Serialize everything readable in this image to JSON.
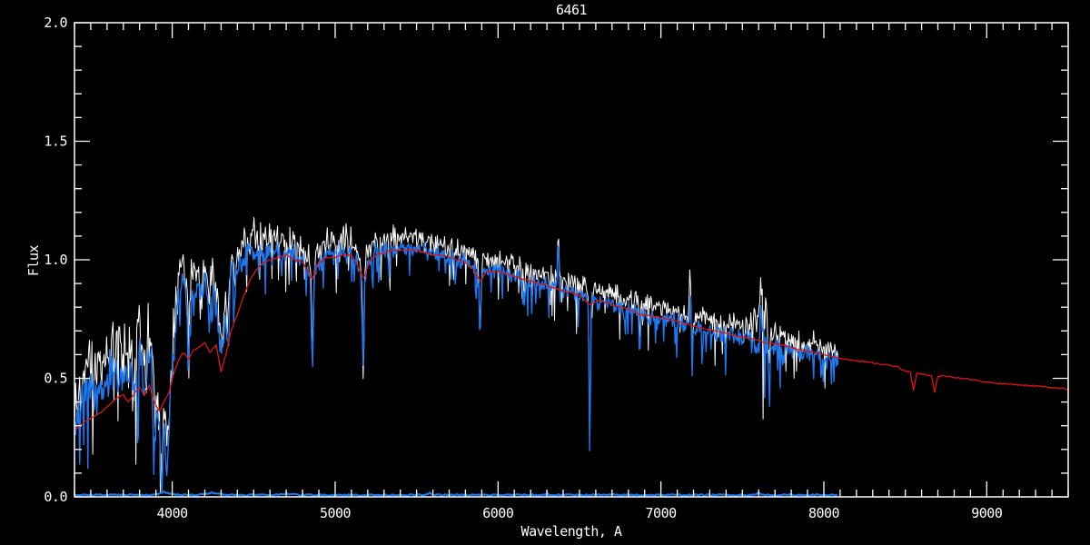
{
  "title": "6461",
  "colors": {
    "background": "#000000",
    "frame": "#ffffff",
    "observed_raw": "#ffffff",
    "observed_smoothed": "#1e78f0",
    "model_fit": "#e01414",
    "text": "#ffffff"
  },
  "chart_data": {
    "type": "line",
    "title": "6461",
    "xlabel": "Wavelength, A",
    "ylabel": "Flux",
    "xlim": [
      3400,
      9500
    ],
    "ylim": [
      0.0,
      2.0
    ],
    "grid": false,
    "legend": null,
    "x_major_ticks": [
      4000,
      5000,
      6000,
      7000,
      8000,
      9000
    ],
    "x_tick_labels": [
      "4000",
      "5000",
      "6000",
      "7000",
      "8000",
      "9000"
    ],
    "x_minor_step": 100,
    "y_major_ticks": [
      0.0,
      0.5,
      1.0,
      1.5,
      2.0
    ],
    "y_tick_labels": [
      "0.0",
      "0.5",
      "1.0",
      "1.5",
      "2.0"
    ],
    "y_minor_step": 0.1,
    "seed": 77731,
    "observed_range": [
      3402,
      8090
    ],
    "series": [
      {
        "name": "observed-raw",
        "color": "#ffffff",
        "style": "noisy",
        "offset": 0.02,
        "noise_scale": 1.3,
        "bias": 0.5,
        "stroke": 1.0
      },
      {
        "name": "observed-smoothed",
        "color": "#1e78f0",
        "style": "noisy",
        "offset": 0.0,
        "noise_scale": 1.0,
        "bias": 0.0,
        "stroke": 1.4
      },
      {
        "name": "noise-floor",
        "color": "#1e78f0",
        "style": "flat",
        "xrange": [
          3402,
          8090
        ],
        "level": 0.008,
        "stroke": 2.2
      },
      {
        "name": "model-fit",
        "color": "#e01414",
        "style": "smooth",
        "stroke": 1.3,
        "jitter": 0.006,
        "points": [
          [
            3400,
            0.28
          ],
          [
            3450,
            0.31
          ],
          [
            3500,
            0.33
          ],
          [
            3550,
            0.35
          ],
          [
            3600,
            0.38
          ],
          [
            3650,
            0.41
          ],
          [
            3700,
            0.43
          ],
          [
            3730,
            0.4
          ],
          [
            3770,
            0.44
          ],
          [
            3800,
            0.46
          ],
          [
            3830,
            0.43
          ],
          [
            3860,
            0.47
          ],
          [
            3890,
            0.4
          ],
          [
            3920,
            0.36
          ],
          [
            3950,
            0.4
          ],
          [
            3980,
            0.44
          ],
          [
            4010,
            0.52
          ],
          [
            4040,
            0.58
          ],
          [
            4070,
            0.61
          ],
          [
            4100,
            0.58
          ],
          [
            4130,
            0.62
          ],
          [
            4160,
            0.63
          ],
          [
            4200,
            0.65
          ],
          [
            4230,
            0.61
          ],
          [
            4270,
            0.64
          ],
          [
            4300,
            0.53
          ],
          [
            4330,
            0.6
          ],
          [
            4360,
            0.7
          ],
          [
            4400,
            0.77
          ],
          [
            4440,
            0.85
          ],
          [
            4480,
            0.92
          ],
          [
            4520,
            0.96
          ],
          [
            4560,
            0.99
          ],
          [
            4600,
            1.0
          ],
          [
            4650,
            1.01
          ],
          [
            4700,
            1.02
          ],
          [
            4750,
            1.0
          ],
          [
            4800,
            0.99
          ],
          [
            4861,
            0.92
          ],
          [
            4900,
            0.99
          ],
          [
            4950,
            1.01
          ],
          [
            5000,
            1.01
          ],
          [
            5050,
            1.02
          ],
          [
            5100,
            1.02
          ],
          [
            5140,
            0.97
          ],
          [
            5175,
            0.92
          ],
          [
            5210,
            0.99
          ],
          [
            5250,
            1.02
          ],
          [
            5300,
            1.03
          ],
          [
            5350,
            1.04
          ],
          [
            5400,
            1.04
          ],
          [
            5450,
            1.04
          ],
          [
            5500,
            1.04
          ],
          [
            5550,
            1.03
          ],
          [
            5600,
            1.02
          ],
          [
            5650,
            1.02
          ],
          [
            5700,
            1.01
          ],
          [
            5750,
            1.0
          ],
          [
            5800,
            0.99
          ],
          [
            5850,
            0.96
          ],
          [
            5893,
            0.91
          ],
          [
            5930,
            0.95
          ],
          [
            6000,
            0.95
          ],
          [
            6100,
            0.93
          ],
          [
            6200,
            0.91
          ],
          [
            6300,
            0.89
          ],
          [
            6400,
            0.87
          ],
          [
            6500,
            0.85
          ],
          [
            6563,
            0.81
          ],
          [
            6620,
            0.83
          ],
          [
            6700,
            0.81
          ],
          [
            6800,
            0.79
          ],
          [
            6870,
            0.77
          ],
          [
            6950,
            0.76
          ],
          [
            7050,
            0.75
          ],
          [
            7150,
            0.73
          ],
          [
            7250,
            0.71
          ],
          [
            7350,
            0.7
          ],
          [
            7450,
            0.68
          ],
          [
            7550,
            0.67
          ],
          [
            7650,
            0.65
          ],
          [
            7750,
            0.64
          ],
          [
            7850,
            0.62
          ],
          [
            7950,
            0.61
          ],
          [
            8050,
            0.59
          ],
          [
            8150,
            0.58
          ],
          [
            8250,
            0.57
          ],
          [
            8350,
            0.56
          ],
          [
            8450,
            0.55
          ],
          [
            8500,
            0.53
          ],
          [
            8530,
            0.53
          ],
          [
            8550,
            0.45
          ],
          [
            8570,
            0.52
          ],
          [
            8600,
            0.52
          ],
          [
            8660,
            0.51
          ],
          [
            8680,
            0.44
          ],
          [
            8700,
            0.51
          ],
          [
            8750,
            0.51
          ],
          [
            8850,
            0.5
          ],
          [
            8950,
            0.49
          ],
          [
            9050,
            0.48
          ],
          [
            9150,
            0.475
          ],
          [
            9250,
            0.47
          ],
          [
            9350,
            0.465
          ],
          [
            9500,
            0.455
          ]
        ]
      }
    ],
    "observed_envelope": [
      [
        3402,
        0.3
      ],
      [
        3450,
        0.4
      ],
      [
        3500,
        0.46
      ],
      [
        3550,
        0.42
      ],
      [
        3600,
        0.5
      ],
      [
        3650,
        0.54
      ],
      [
        3700,
        0.55
      ],
      [
        3730,
        0.48
      ],
      [
        3760,
        0.55
      ],
      [
        3800,
        0.62
      ],
      [
        3830,
        0.55
      ],
      [
        3860,
        0.62
      ],
      [
        3890,
        0.48
      ],
      [
        3915,
        0.32
      ],
      [
        3935,
        0.25
      ],
      [
        3955,
        0.3
      ],
      [
        3975,
        0.28
      ],
      [
        4000,
        0.55
      ],
      [
        4030,
        0.82
      ],
      [
        4060,
        0.9
      ],
      [
        4100,
        0.86
      ],
      [
        4150,
        0.88
      ],
      [
        4200,
        0.9
      ],
      [
        4230,
        0.84
      ],
      [
        4260,
        0.86
      ],
      [
        4290,
        0.68
      ],
      [
        4310,
        0.6
      ],
      [
        4330,
        0.82
      ],
      [
        4360,
        0.94
      ],
      [
        4400,
        0.96
      ],
      [
        4440,
        1.02
      ],
      [
        4480,
        1.05
      ],
      [
        4520,
        1.04
      ],
      [
        4560,
        1.03
      ],
      [
        4600,
        1.03
      ],
      [
        4650,
        1.04
      ],
      [
        4700,
        1.03
      ],
      [
        4750,
        1.01
      ],
      [
        4800,
        1.0
      ],
      [
        4840,
        0.97
      ],
      [
        4880,
        0.96
      ],
      [
        4920,
        1.0
      ],
      [
        4960,
        1.02
      ],
      [
        5000,
        1.02
      ],
      [
        5050,
        1.04
      ],
      [
        5100,
        1.03
      ],
      [
        5140,
        0.99
      ],
      [
        5175,
        0.93
      ],
      [
        5210,
        1.0
      ],
      [
        5250,
        1.03
      ],
      [
        5300,
        1.04
      ],
      [
        5350,
        1.04
      ],
      [
        5400,
        1.05
      ],
      [
        5450,
        1.05
      ],
      [
        5500,
        1.04
      ],
      [
        5550,
        1.03
      ],
      [
        5600,
        1.02
      ],
      [
        5650,
        1.02
      ],
      [
        5700,
        1.01
      ],
      [
        5750,
        1.0
      ],
      [
        5800,
        0.99
      ],
      [
        5850,
        0.97
      ],
      [
        5890,
        0.94
      ],
      [
        5930,
        0.96
      ],
      [
        6000,
        0.95
      ],
      [
        6050,
        0.94
      ],
      [
        6100,
        0.93
      ],
      [
        6150,
        0.92
      ],
      [
        6200,
        0.91
      ],
      [
        6250,
        0.9
      ],
      [
        6300,
        0.89
      ],
      [
        6350,
        0.88
      ],
      [
        6400,
        0.87
      ],
      [
        6450,
        0.86
      ],
      [
        6500,
        0.85
      ],
      [
        6550,
        0.84
      ],
      [
        6600,
        0.83
      ],
      [
        6650,
        0.82
      ],
      [
        6700,
        0.81
      ],
      [
        6750,
        0.8
      ],
      [
        6800,
        0.79
      ],
      [
        6850,
        0.78
      ],
      [
        6900,
        0.77
      ],
      [
        6950,
        0.76
      ],
      [
        7000,
        0.76
      ],
      [
        7050,
        0.75
      ],
      [
        7100,
        0.74
      ],
      [
        7150,
        0.73
      ],
      [
        7200,
        0.72
      ],
      [
        7250,
        0.71
      ],
      [
        7300,
        0.7
      ],
      [
        7350,
        0.69
      ],
      [
        7400,
        0.68
      ],
      [
        7450,
        0.68
      ],
      [
        7500,
        0.67
      ],
      [
        7550,
        0.66
      ],
      [
        7600,
        0.65
      ],
      [
        7650,
        0.64
      ],
      [
        7700,
        0.64
      ],
      [
        7750,
        0.63
      ],
      [
        7800,
        0.62
      ],
      [
        7850,
        0.61
      ],
      [
        7900,
        0.61
      ],
      [
        7950,
        0.6
      ],
      [
        8000,
        0.59
      ],
      [
        8050,
        0.59
      ],
      [
        8090,
        0.58
      ]
    ],
    "absorption_lines": [
      [
        3770,
        0.15,
        8
      ],
      [
        3835,
        0.18,
        8
      ],
      [
        3890,
        0.22,
        8
      ],
      [
        3934,
        0.18,
        9
      ],
      [
        3969,
        0.16,
        9
      ],
      [
        4102,
        0.22,
        7
      ],
      [
        4227,
        0.1,
        4
      ],
      [
        4340,
        0.22,
        6
      ],
      [
        4383,
        0.12,
        4
      ],
      [
        4668,
        0.08,
        4
      ],
      [
        4861,
        0.42,
        5
      ],
      [
        5172,
        0.4,
        5
      ],
      [
        5270,
        0.14,
        4
      ],
      [
        5332,
        0.12,
        4
      ],
      [
        5890,
        0.28,
        5
      ],
      [
        6162,
        0.1,
        4
      ],
      [
        6563,
        0.66,
        4
      ],
      [
        6870,
        0.16,
        4
      ],
      [
        7190,
        0.1,
        4
      ],
      [
        7665,
        0.12,
        5
      ]
    ],
    "emission_spikes": [
      [
        6369,
        0.22,
        4
      ],
      [
        7179,
        0.2,
        4
      ],
      [
        7614,
        0.18,
        4
      ]
    ],
    "noise_amplitude": [
      [
        3402,
        0.11
      ],
      [
        3850,
        0.12
      ],
      [
        3980,
        0.11
      ],
      [
        4050,
        0.085
      ],
      [
        4400,
        0.065
      ],
      [
        4800,
        0.055
      ],
      [
        5200,
        0.05
      ],
      [
        5800,
        0.045
      ],
      [
        6300,
        0.04
      ],
      [
        7000,
        0.04
      ],
      [
        7540,
        0.045
      ],
      [
        7600,
        0.12
      ],
      [
        7640,
        0.1
      ],
      [
        7680,
        0.045
      ],
      [
        8090,
        0.042
      ]
    ],
    "floor_bumps": [
      [
        3950,
        0.012,
        30
      ],
      [
        4250,
        0.01,
        40
      ],
      [
        4700,
        0.006,
        30
      ],
      [
        5577,
        0.012,
        5
      ],
      [
        6300,
        0.008,
        5
      ],
      [
        7600,
        0.01,
        8
      ]
    ]
  }
}
